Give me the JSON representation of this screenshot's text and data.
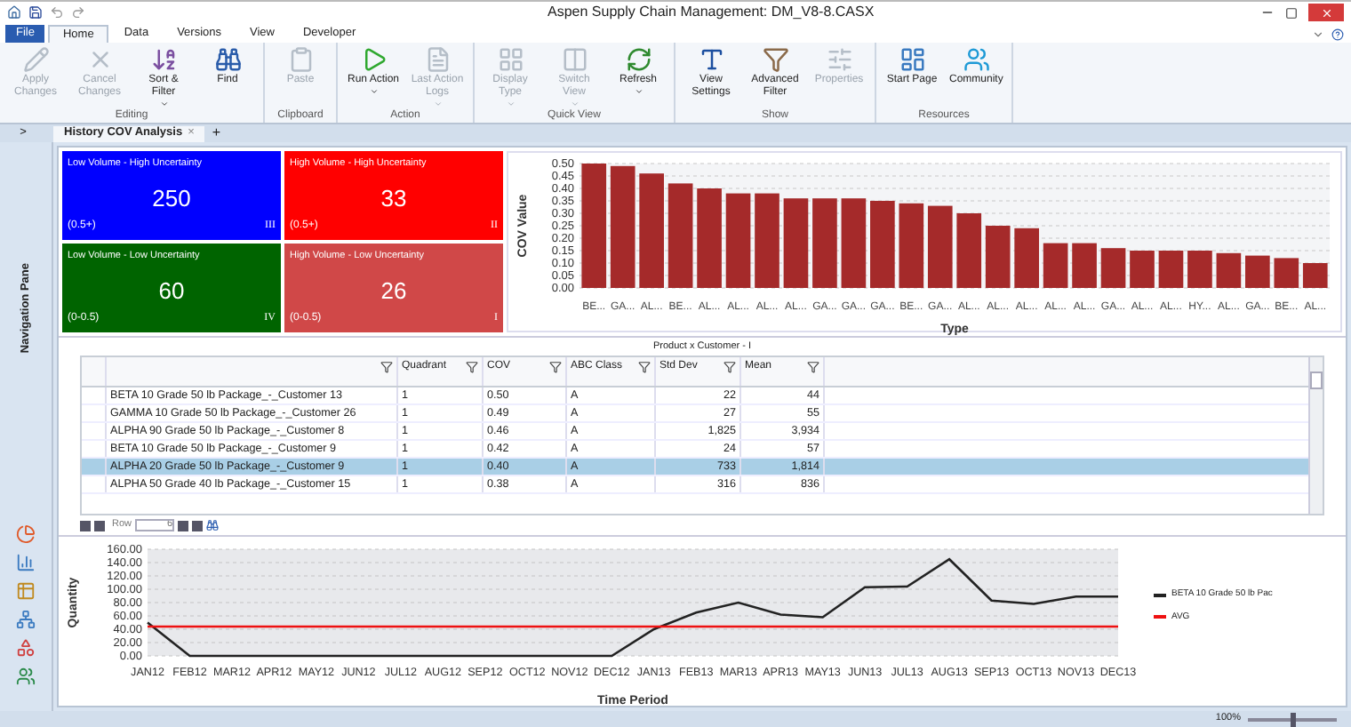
{
  "window": {
    "title": "Aspen Supply Chain Management: DM_V8-8.CASX"
  },
  "menu_tabs": [
    {
      "label": "File",
      "selected": false,
      "kind": "file"
    },
    {
      "label": "Home",
      "selected": true,
      "kind": "tab"
    },
    {
      "label": "Data",
      "selected": false,
      "kind": "tab"
    },
    {
      "label": "Versions",
      "selected": false,
      "kind": "tab"
    },
    {
      "label": "View",
      "selected": false,
      "kind": "tab"
    },
    {
      "label": "Developer",
      "selected": false,
      "kind": "tab"
    }
  ],
  "ribbon": [
    {
      "label": "Editing",
      "buttons": [
        {
          "label": "Apply Changes",
          "disabled": true,
          "dropdown": false
        },
        {
          "label": "Cancel Changes",
          "disabled": true,
          "dropdown": false
        },
        {
          "label": "Sort & Filter",
          "disabled": false,
          "dropdown": true
        },
        {
          "label": "Find",
          "disabled": false,
          "dropdown": false
        }
      ]
    },
    {
      "label": "Clipboard",
      "buttons": [
        {
          "label": "Paste",
          "disabled": true,
          "dropdown": false
        }
      ]
    },
    {
      "label": "Action",
      "buttons": [
        {
          "label": "Run Action",
          "disabled": false,
          "dropdown": true
        },
        {
          "label": "Last Action Logs",
          "disabled": true,
          "dropdown": true
        }
      ]
    },
    {
      "label": "Quick View",
      "buttons": [
        {
          "label": "Display Type",
          "disabled": true,
          "dropdown": true
        },
        {
          "label": "Switch View",
          "disabled": true,
          "dropdown": true
        },
        {
          "label": "Refresh",
          "disabled": false,
          "dropdown": true
        }
      ]
    },
    {
      "label": "Show",
      "buttons": [
        {
          "label": "View Settings",
          "disabled": false,
          "dropdown": false
        },
        {
          "label": "Advanced Filter",
          "disabled": false,
          "dropdown": false
        },
        {
          "label": "Properties",
          "disabled": true,
          "dropdown": false
        }
      ]
    },
    {
      "label": "Resources",
      "buttons": [
        {
          "label": "Start Page",
          "disabled": false,
          "dropdown": false
        },
        {
          "label": "Community",
          "disabled": false,
          "dropdown": false
        }
      ]
    }
  ],
  "doc_tabs": {
    "toggle": ">",
    "tabs": [
      {
        "label": "History COV Analysis",
        "close": "×",
        "selected": true
      }
    ],
    "add": "+"
  },
  "navigation_pane": {
    "label": "Navigation Pane"
  },
  "quadrants": [
    {
      "title": "Low Volume - High Uncertainty",
      "value": "250",
      "range": "(0.5+)",
      "numeral": "III",
      "color": "#0000ff"
    },
    {
      "title": "High Volume - High Uncertainty",
      "value": "33",
      "range": "(0.5+)",
      "numeral": "II",
      "color": "#ff0000"
    },
    {
      "title": "Low Volume - Low Uncertainty",
      "value": "60",
      "range": "(0-0.5)",
      "numeral": "IV",
      "color": "#006400"
    },
    {
      "title": "High Volume - Low Uncertainty",
      "value": "26",
      "range": "(0-0.5)",
      "numeral": "I",
      "color": "#d04848"
    }
  ],
  "cov_chart": {
    "chart_data": {
      "type": "bar",
      "xlabel": "Type",
      "ylabel": "COV Value",
      "categories": [
        "BE...",
        "GA...",
        "AL...",
        "BE...",
        "AL...",
        "AL...",
        "AL...",
        "AL...",
        "GA...",
        "GA...",
        "GA...",
        "BE...",
        "GA...",
        "AL...",
        "AL...",
        "AL...",
        "AL...",
        "AL...",
        "GA...",
        "AL...",
        "AL...",
        "HY...",
        "AL...",
        "GA...",
        "BE...",
        "AL..."
      ],
      "grid": true,
      "series": [
        {
          "color": "#a52a2a",
          "values": [
            0.5,
            0.49,
            0.46,
            0.42,
            0.4,
            0.38,
            0.38,
            0.36,
            0.36,
            0.36,
            0.35,
            0.34,
            0.33,
            0.3,
            0.25,
            0.24,
            0.18,
            0.18,
            0.16,
            0.15,
            0.15,
            0.15,
            0.14,
            0.13,
            0.12,
            0.1
          ]
        }
      ],
      "ylim": [
        0,
        0.5
      ],
      "yticks": [
        {
          "value": 0,
          "label": "0.00"
        },
        {
          "value": 0.05,
          "label": "0.05"
        },
        {
          "value": 0.1,
          "label": "0.10"
        },
        {
          "value": 0.15,
          "label": "0.15"
        },
        {
          "value": 0.2,
          "label": "0.20"
        },
        {
          "value": 0.25,
          "label": "0.25"
        },
        {
          "value": 0.3,
          "label": "0.30"
        },
        {
          "value": 0.35,
          "label": "0.35"
        },
        {
          "value": 0.4,
          "label": "0.40"
        },
        {
          "value": 0.45,
          "label": "0.45"
        },
        {
          "value": 0.5,
          "label": "0.50"
        }
      ]
    }
  },
  "table": {
    "caption": "Product x Customer - I",
    "columns": [
      {
        "filter": true
      },
      {
        "label": "Quadrant",
        "filter": true
      },
      {
        "label": "COV",
        "filter": true
      },
      {
        "label": "ABC Class",
        "filter": true
      },
      {
        "label": "Std Dev",
        "filter": true
      },
      {
        "label": "Mean",
        "filter": true
      }
    ],
    "rows": [
      {
        "cells": [
          "BETA 10 Grade 50 lb Package_-_Customer 13",
          "1",
          "0.50",
          "A",
          "22",
          "44"
        ],
        "selected": false
      },
      {
        "cells": [
          "GAMMA 10 Grade 50 lb Package_-_Customer 26",
          "1",
          "0.49",
          "A",
          "27",
          "55"
        ],
        "selected": false
      },
      {
        "cells": [
          "ALPHA 90 Grade 50 lb Package_-_Customer 8",
          "1",
          "0.46",
          "A",
          "1,825",
          "3,934"
        ],
        "selected": false
      },
      {
        "cells": [
          "BETA 10 Grade 50 lb Package_-_Customer 9",
          "1",
          "0.42",
          "A",
          "24",
          "57"
        ],
        "selected": false
      },
      {
        "cells": [
          "ALPHA 20 Grade 50 lb Package_-_Customer 9",
          "1",
          "0.40",
          "A",
          "733",
          "1,814"
        ],
        "selected": true
      },
      {
        "cells": [
          "ALPHA 50 Grade 40 lb Package_-_Customer 15",
          "1",
          "0.38",
          "A",
          "316",
          "836"
        ],
        "selected": false
      }
    ],
    "navigator": {
      "label": "Row",
      "value": "6"
    }
  },
  "quantity_chart": {
    "chart_data": {
      "type": "line",
      "xlabel": "Time Period",
      "ylabel": "Quantity",
      "grid": true,
      "categories": [
        "JAN12",
        "FEB12",
        "MAR12",
        "APR12",
        "MAY12",
        "JUN12",
        "JUL12",
        "AUG12",
        "SEP12",
        "OCT12",
        "NOV12",
        "DEC12",
        "JAN13",
        "FEB13",
        "MAR13",
        "APR13",
        "MAY13",
        "JUN13",
        "JUL13",
        "AUG13",
        "SEP13",
        "OCT13",
        "NOV13",
        "DEC13"
      ],
      "series": [
        {
          "name": "BETA 10 Grade 50 lb Pac",
          "color": "#222222",
          "values": [
            50,
            0,
            0,
            0,
            0,
            0,
            0,
            0,
            0,
            0,
            0,
            0,
            40,
            65,
            80,
            62,
            58,
            103,
            104,
            145,
            83,
            78,
            89,
            89
          ]
        },
        {
          "name": "AVG",
          "color": "#ee1111",
          "values": [
            44,
            44,
            44,
            44,
            44,
            44,
            44,
            44,
            44,
            44,
            44,
            44,
            44,
            44,
            44,
            44,
            44,
            44,
            44,
            44,
            44,
            44,
            44,
            44
          ]
        }
      ],
      "ylim": [
        0,
        160
      ],
      "yticks": [
        {
          "value": 0,
          "label": "0.00"
        },
        {
          "value": 20,
          "label": "20.00"
        },
        {
          "value": 40,
          "label": "40.00"
        },
        {
          "value": 60,
          "label": "60.00"
        },
        {
          "value": 80,
          "label": "80.00"
        },
        {
          "value": 100,
          "label": "100.00"
        },
        {
          "value": 120,
          "label": "120.00"
        },
        {
          "value": 140,
          "label": "140.00"
        },
        {
          "value": 160,
          "label": "160.00"
        }
      ]
    }
  },
  "status_bar": {
    "zoom": "100%",
    "zoom_slider": {
      "level": 0.5
    }
  }
}
